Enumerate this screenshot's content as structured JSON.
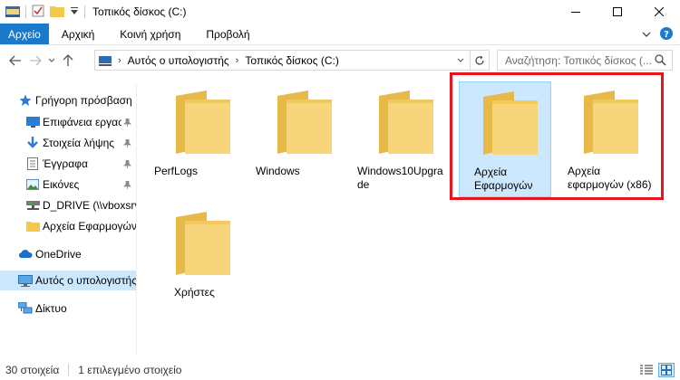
{
  "window": {
    "title": "Τοπικός δίσκος (C:)"
  },
  "ribbon": {
    "tabs": [
      "Αρχείο",
      "Αρχική",
      "Κοινή χρήση",
      "Προβολή"
    ]
  },
  "address": {
    "parts": [
      "Αυτός ο υπολογιστής",
      "Τοπικός δίσκος (C:)"
    ]
  },
  "search": {
    "placeholder": "Αναζήτηση: Τοπικός δίσκος (..."
  },
  "navpane": {
    "items": [
      {
        "label": "Γρήγορη πρόσβαση",
        "icon": "star-icon",
        "pinned": false
      },
      {
        "label": "Επιφάνεια εργασ",
        "icon": "desktop-icon",
        "pinned": true
      },
      {
        "label": "Στοιχεία λήψης",
        "icon": "download-icon",
        "pinned": true
      },
      {
        "label": "Έγγραφα",
        "icon": "document-icon",
        "pinned": true
      },
      {
        "label": "Εικόνες",
        "icon": "pictures-icon",
        "pinned": true
      },
      {
        "label": "D_DRIVE (\\\\vboxsrv)",
        "icon": "network-drive-icon",
        "pinned": false
      },
      {
        "label": "Αρχεία Εφαρμογών",
        "icon": "folder-icon",
        "pinned": false
      },
      {
        "label": "OneDrive",
        "icon": "onedrive-icon",
        "pinned": false
      },
      {
        "label": "Αυτός ο υπολογιστής",
        "icon": "computer-icon",
        "pinned": false,
        "selected": true
      },
      {
        "label": "Δίκτυο",
        "icon": "network-icon",
        "pinned": false
      }
    ]
  },
  "folders": [
    {
      "label": "PerfLogs"
    },
    {
      "label": "Windows"
    },
    {
      "label": "Windows10Upgrade"
    },
    {
      "label": "Αρχεία Εφαρμογών",
      "selected": true
    },
    {
      "label": "Αρχεία εφαρμογών (x86)"
    },
    {
      "label": "Χρήστες"
    }
  ],
  "status": {
    "count": "30 στοιχεία",
    "selected": "1 επιλεγμένο στοιχείο"
  },
  "colors": {
    "accent": "#1979ca",
    "selection": "#cce8ff",
    "folder": "#f7d57a",
    "highlight": "#e8141b"
  }
}
